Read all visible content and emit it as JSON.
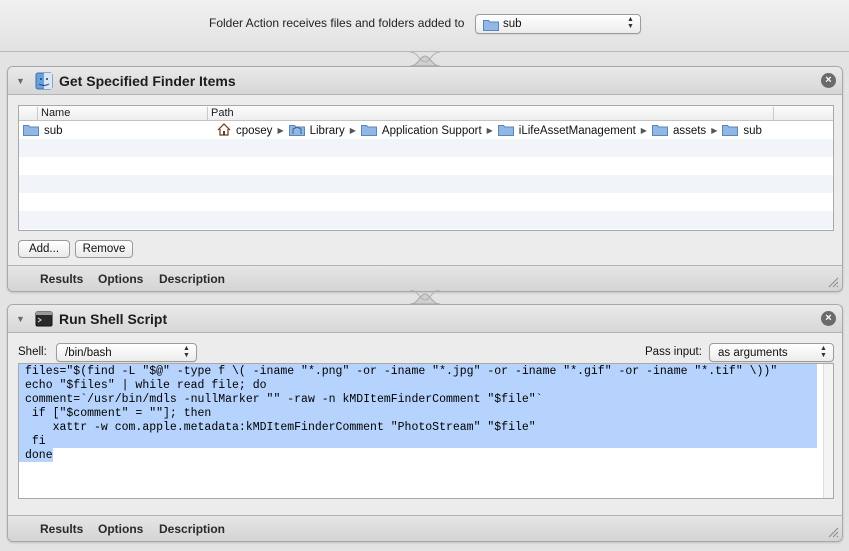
{
  "header": {
    "label": "Folder Action receives files and folders added to",
    "folder_value": "sub",
    "folder_icon": "folder-icon"
  },
  "actions": {
    "finder_items": {
      "title": "Get Specified Finder Items",
      "icon": "finder-icon",
      "columns": {
        "name": "Name",
        "path": "Path"
      },
      "rows": [
        {
          "name": "sub",
          "path": [
            {
              "label": "cposey",
              "icon": "home-icon"
            },
            {
              "label": "Library",
              "icon": "library-folder-icon"
            },
            {
              "label": "Application Support",
              "icon": "folder-icon"
            },
            {
              "label": "iLifeAssetManagement",
              "icon": "folder-icon"
            },
            {
              "label": "assets",
              "icon": "folder-icon"
            },
            {
              "label": "sub",
              "icon": "folder-icon"
            }
          ]
        }
      ],
      "buttons": {
        "add": "Add...",
        "remove": "Remove"
      },
      "footer_tabs": {
        "results": "Results",
        "options": "Options",
        "description": "Description"
      }
    },
    "shell_script": {
      "title": "Run Shell Script",
      "icon": "terminal-icon",
      "shell_label": "Shell:",
      "shell_value": "/bin/bash",
      "pass_input_label": "Pass input:",
      "pass_input_value": "as arguments",
      "script": "files=\"$(find -L \"$@\" -type f \\( -iname \"*.png\" -or -iname \"*.jpg\" -or -iname \"*.gif\" -or -iname \"*.tif\" \\))\"\necho \"$files\" | while read file; do\ncomment=`/usr/bin/mdls -nullMarker \"\" -raw -n kMDItemFinderComment \"$file\"`\n if [\"$comment\" = \"\"]; then\n    xattr -w com.apple.metadata:kMDItemFinderComment \"PhotoStream\" \"$file\"\n fi\ndone",
      "footer_tabs": {
        "results": "Results",
        "options": "Options",
        "description": "Description"
      }
    }
  },
  "colors": {
    "selection": "#b5d3fd",
    "alt_row": "#f1f5fa",
    "folder_blue": "#8fb8e6"
  }
}
